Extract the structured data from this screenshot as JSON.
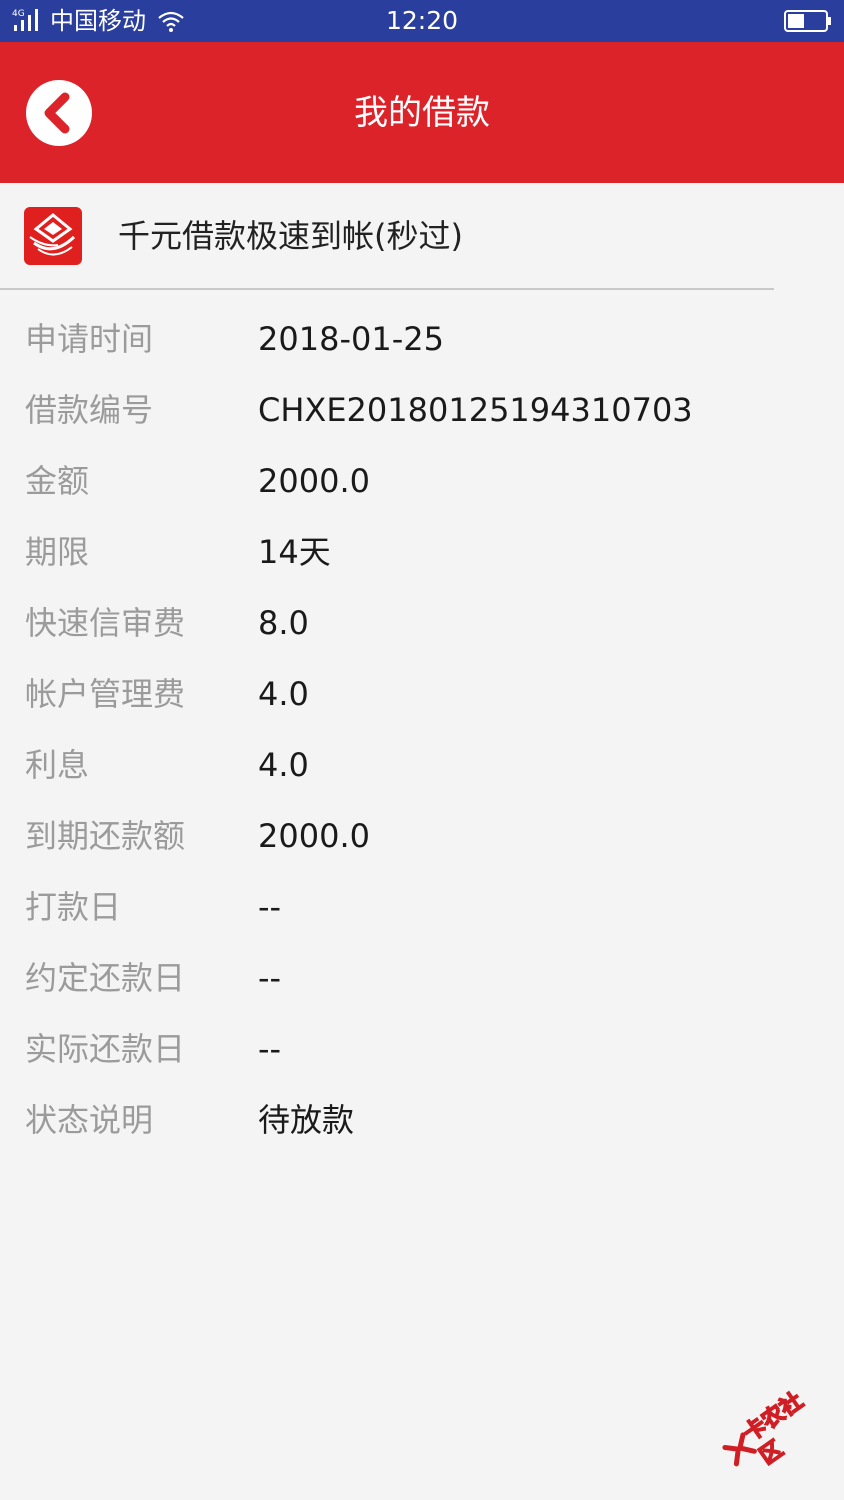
{
  "status_bar": {
    "network": "4G",
    "carrier": "中国移动",
    "time": "12:20"
  },
  "nav": {
    "title": "我的借款"
  },
  "product": {
    "name": "千元借款极速到帐(秒过)"
  },
  "details": [
    {
      "label": "申请时间",
      "value": "2018-01-25"
    },
    {
      "label": "借款编号",
      "value": "CHXE20180125194310703"
    },
    {
      "label": "金额",
      "value": "2000.0"
    },
    {
      "label": "期限",
      "value": "14天"
    },
    {
      "label": "快速信审费",
      "value": "8.0"
    },
    {
      "label": "帐户管理费",
      "value": "4.0"
    },
    {
      "label": "利息",
      "value": "4.0"
    },
    {
      "label": "到期还款额",
      "value": "2000.0"
    },
    {
      "label": "打款日",
      "value": "--"
    },
    {
      "label": "约定还款日",
      "value": "--"
    },
    {
      "label": "实际还款日",
      "value": "--"
    },
    {
      "label": "状态说明",
      "value": "待放款"
    }
  ],
  "watermark": {
    "text": "卡农社区"
  },
  "colors": {
    "status_bar_bg": "#2a3f9d",
    "nav_bg": "#dd232a",
    "page_bg": "#f4f4f4",
    "label_text": "#9b9b9b",
    "value_text": "#1a1a1a"
  },
  "icons": {
    "back": "back-chevron-icon",
    "product": "product-logo-icon",
    "signal": "signal-icon",
    "wifi": "wifi-icon",
    "battery": "battery-icon"
  }
}
